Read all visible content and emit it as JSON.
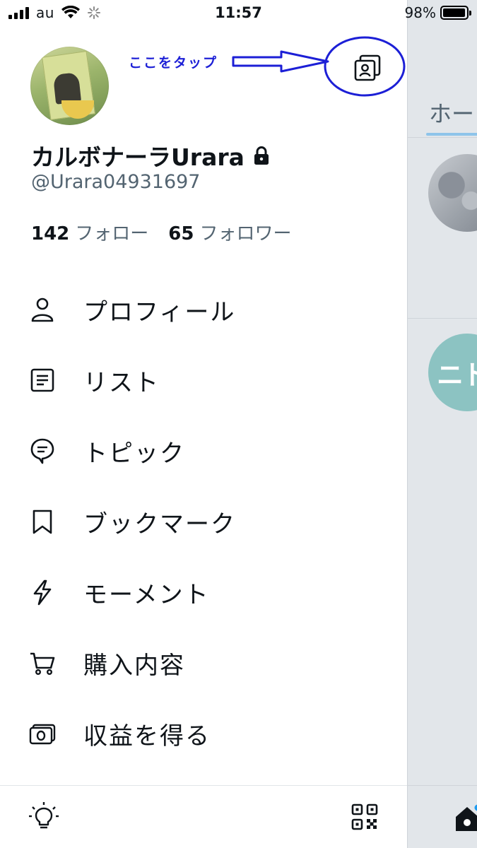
{
  "status_bar": {
    "carrier": "au",
    "time": "11:57",
    "battery": "98%",
    "battery_level": 0.98
  },
  "annotation": {
    "text": "ここをタップ"
  },
  "profile": {
    "display_name": "カルボナーラUrara",
    "handle": "@Urara04931697",
    "following_count": "142",
    "following_label": "フォロー",
    "followers_count": "65",
    "followers_label": "フォロワー"
  },
  "menu": {
    "items": [
      {
        "label": "プロフィール",
        "icon": "person-icon"
      },
      {
        "label": "リスト",
        "icon": "list-icon"
      },
      {
        "label": "トピック",
        "icon": "topic-icon"
      },
      {
        "label": "ブックマーク",
        "icon": "bookmark-icon"
      },
      {
        "label": "モーメント",
        "icon": "lightning-icon"
      },
      {
        "label": "購入内容",
        "icon": "cart-icon"
      },
      {
        "label": "収益を得る",
        "icon": "money-icon"
      }
    ]
  },
  "timeline_peek": {
    "tab_label": "ホー",
    "avatar2_text": "ニト"
  },
  "colors": {
    "annotation": "#1c1fd6",
    "text_primary": "#0f1419",
    "text_secondary": "#536471",
    "tab_underline": "#8ec4ea",
    "timeline_bg": "#e2e6ea"
  }
}
